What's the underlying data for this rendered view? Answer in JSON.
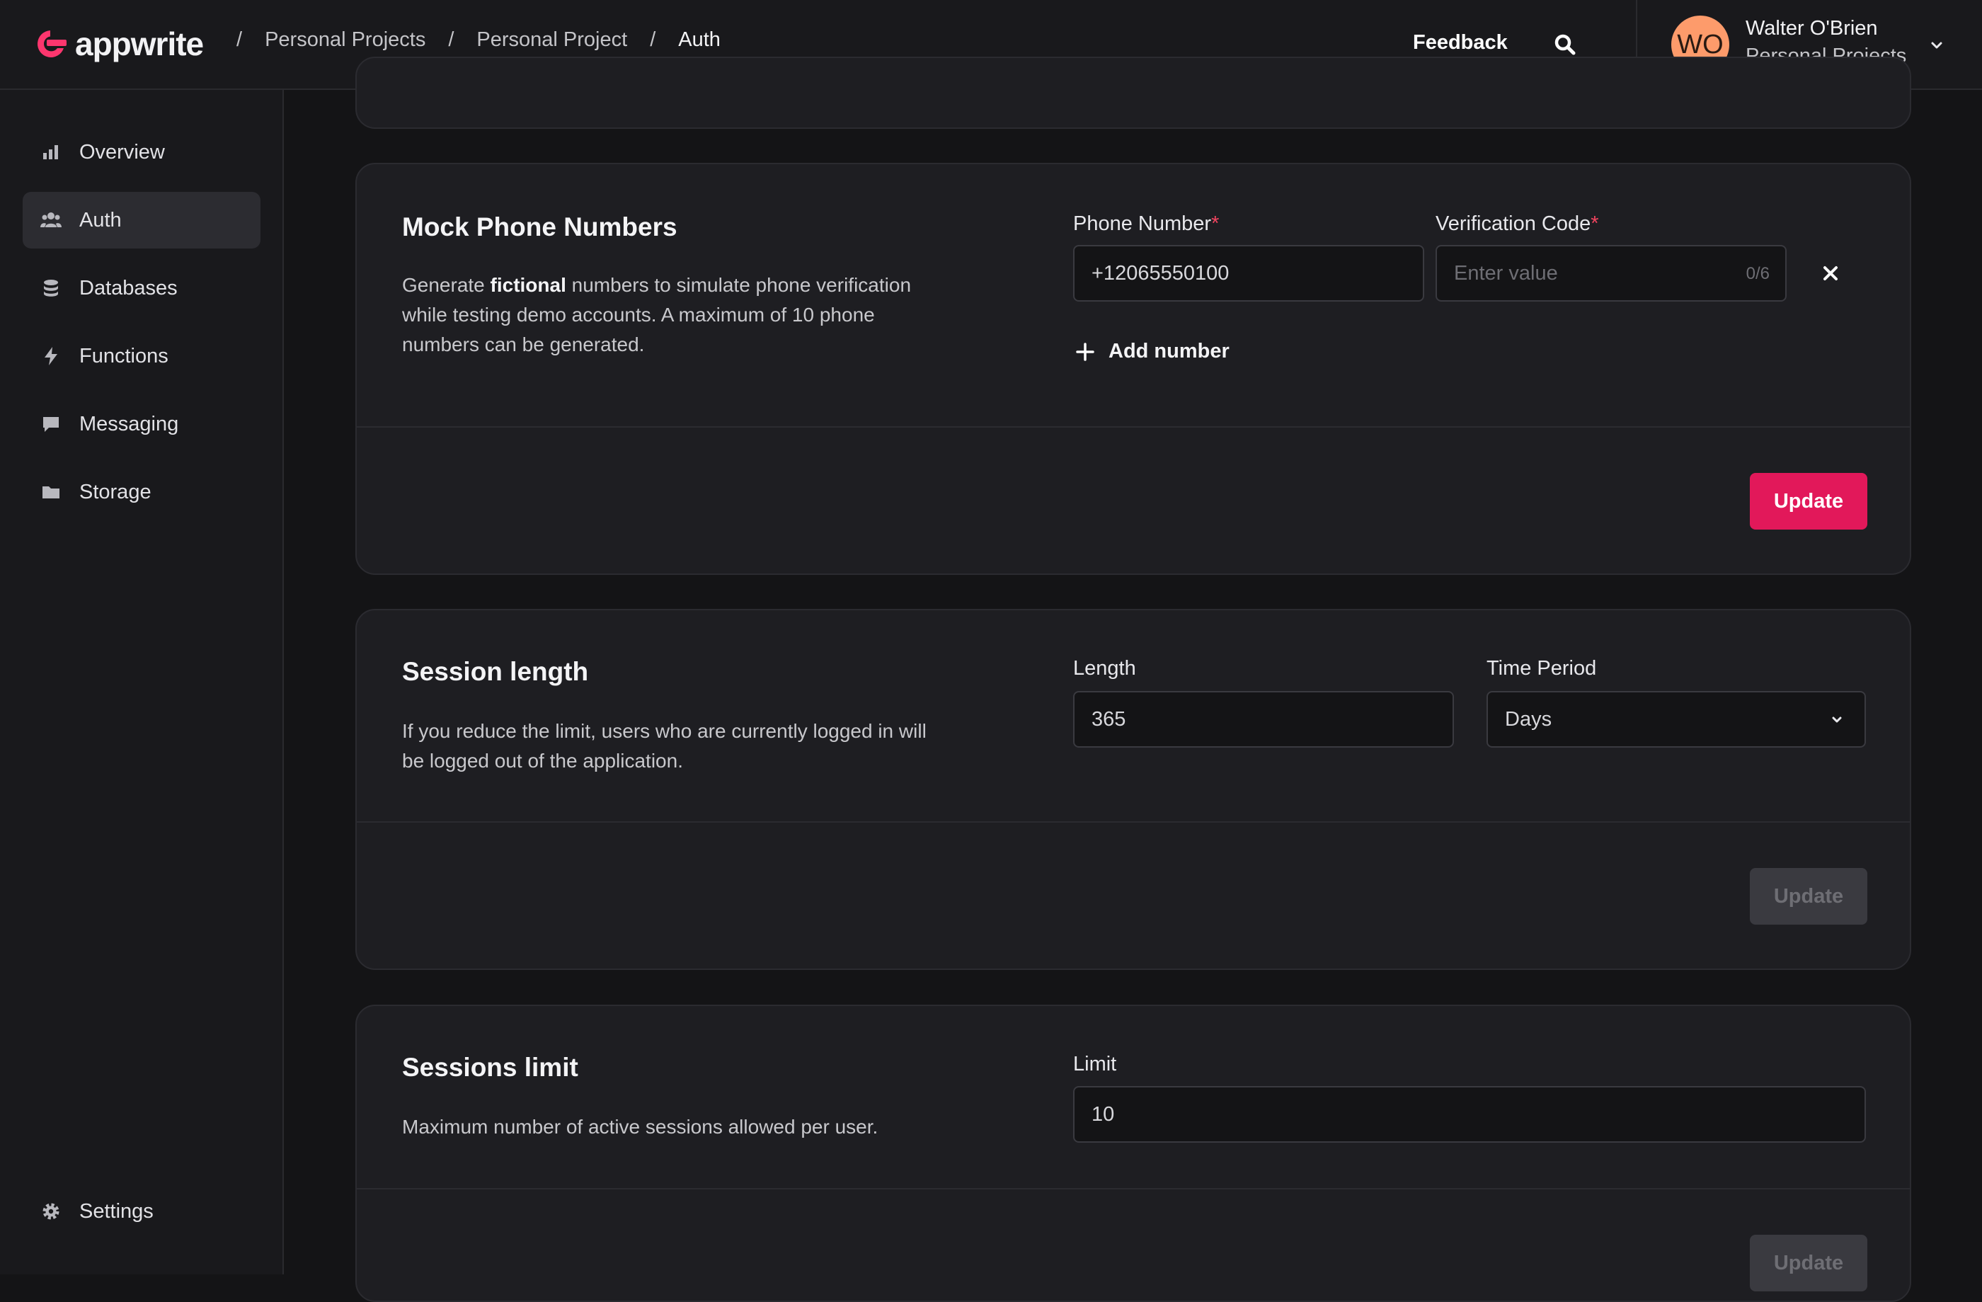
{
  "brand": {
    "name": "appwrite",
    "accent": "#FD366E"
  },
  "breadcrumb": [
    "Personal Projects",
    "Personal Project",
    "Auth"
  ],
  "header": {
    "feedback": "Feedback"
  },
  "user": {
    "initials": "WO",
    "name": "Walter O'Brien",
    "org": "Personal Projects"
  },
  "sidebar": {
    "items": [
      {
        "label": "Overview",
        "icon": "chart-bar-icon"
      },
      {
        "label": "Auth",
        "icon": "users-icon",
        "active": true
      },
      {
        "label": "Databases",
        "icon": "database-icon"
      },
      {
        "label": "Functions",
        "icon": "lightning-icon"
      },
      {
        "label": "Messaging",
        "icon": "chat-icon"
      },
      {
        "label": "Storage",
        "icon": "folder-icon"
      }
    ],
    "settings": {
      "label": "Settings",
      "icon": "cog-icon"
    }
  },
  "mock_phone": {
    "title": "Mock Phone Numbers",
    "desc_before": "Generate ",
    "desc_bold": "fictional",
    "desc_after": " numbers to simulate phone verification while testing demo accounts. A maximum of 10 phone numbers can be generated.",
    "phone_label": "Phone Number",
    "phone_value": "+12065550100",
    "code_label": "Verification Code",
    "code_placeholder": "Enter value",
    "code_counter": "0/6",
    "add_label": "Add number",
    "update_label": "Update"
  },
  "session_length": {
    "title": "Session length",
    "desc": "If you reduce the limit, users who are currently logged in will be logged out of the application.",
    "length_label": "Length",
    "length_value": "365",
    "period_label": "Time Period",
    "period_value": "Days",
    "update_label": "Update"
  },
  "sessions_limit": {
    "title": "Sessions limit",
    "desc": "Maximum number of active sessions allowed per user.",
    "limit_label": "Limit",
    "limit_value": "10",
    "update_label": "Update"
  }
}
